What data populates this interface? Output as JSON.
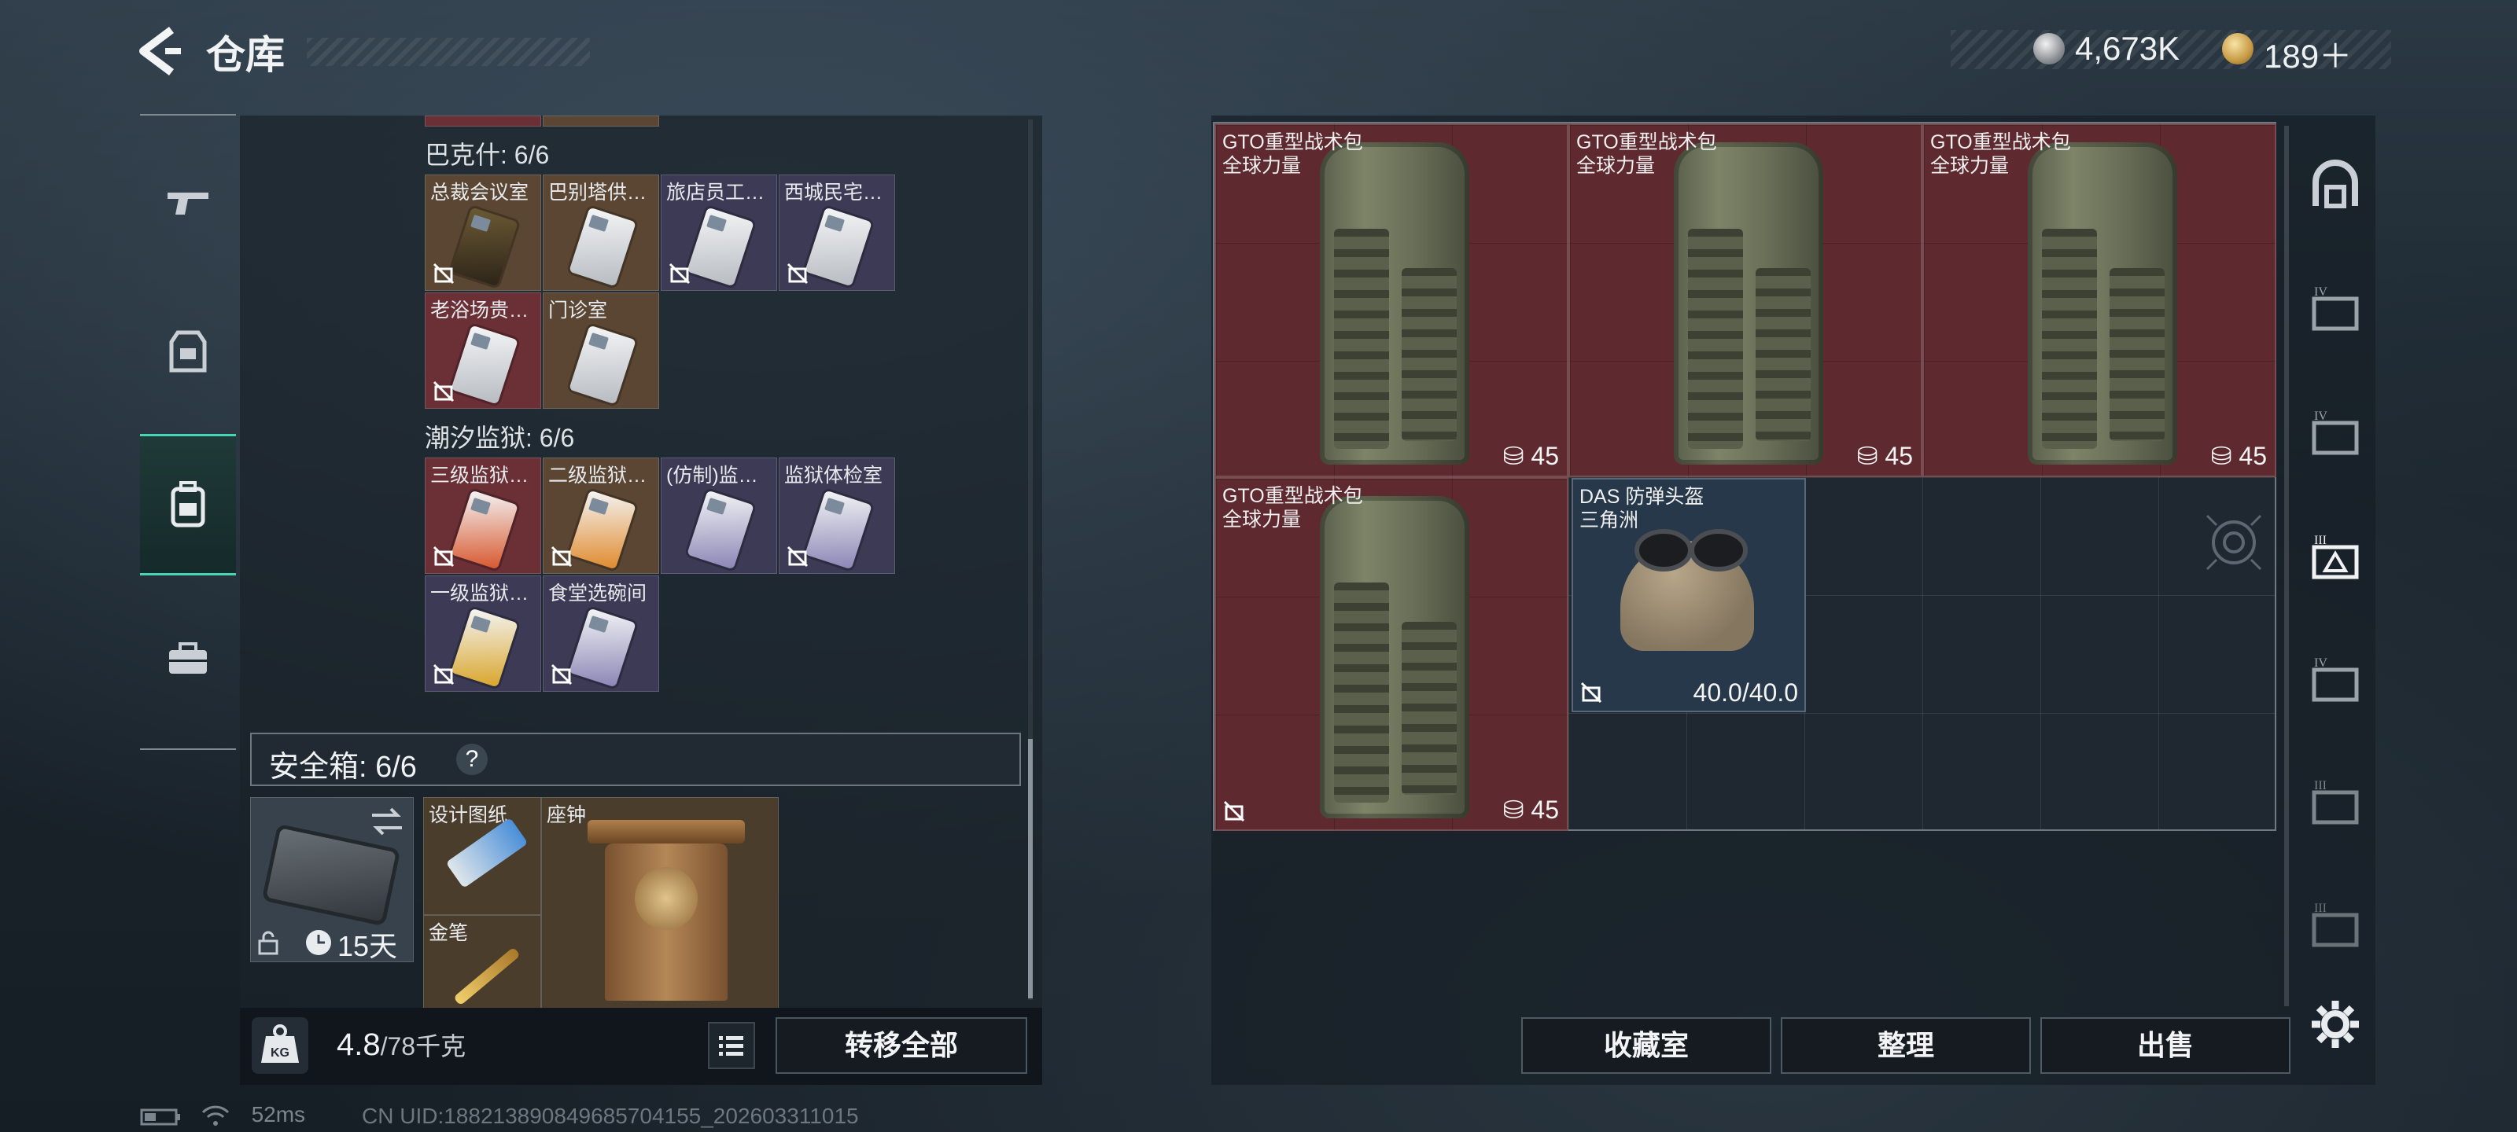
{
  "header": {
    "title": "仓库",
    "currency_silver": "4,673K",
    "currency_gold": "189＋"
  },
  "left": {
    "prev_group_label": "巴克什: 6/6",
    "group_bakeshi": [
      "总裁会议室",
      "巴别塔供…",
      "旅店员工…",
      "西城民宅…",
      "老浴场贵…",
      "门诊室"
    ],
    "prison_label": "潮汐监狱: 6/6",
    "group_prison": [
      "三级监狱…",
      "二级监狱…",
      "(仿制)监…",
      "监狱体检室",
      "一级监狱…",
      "食堂选碗间"
    ],
    "safe_label": "安全箱: 6/6",
    "safe_help": "?",
    "safe_days": "15天",
    "safe_items": [
      "设计图纸",
      "座钟",
      "金笔"
    ],
    "weight": "4.8",
    "weight_max": "/78千克",
    "transfer_all": "转移全部"
  },
  "right": {
    "bag_name": "GTO重型战术包",
    "bag_origin": "全球力量",
    "bag_count": "45",
    "helmet_name": "DAS 防弹头盔",
    "helmet_origin": "三角洲",
    "helmet_durability": "40.0/40.0",
    "buttons": [
      "收藏室",
      "整理",
      "出售"
    ]
  },
  "footer": {
    "ping": "52ms",
    "uid": "CN UID:1882138908496857041​55_202603311015"
  },
  "colors": {
    "accent": "#47d6b3",
    "rarity_red": "#6b2f36",
    "rarity_gold": "#5a4632",
    "rarity_purple": "#3d3a55"
  }
}
